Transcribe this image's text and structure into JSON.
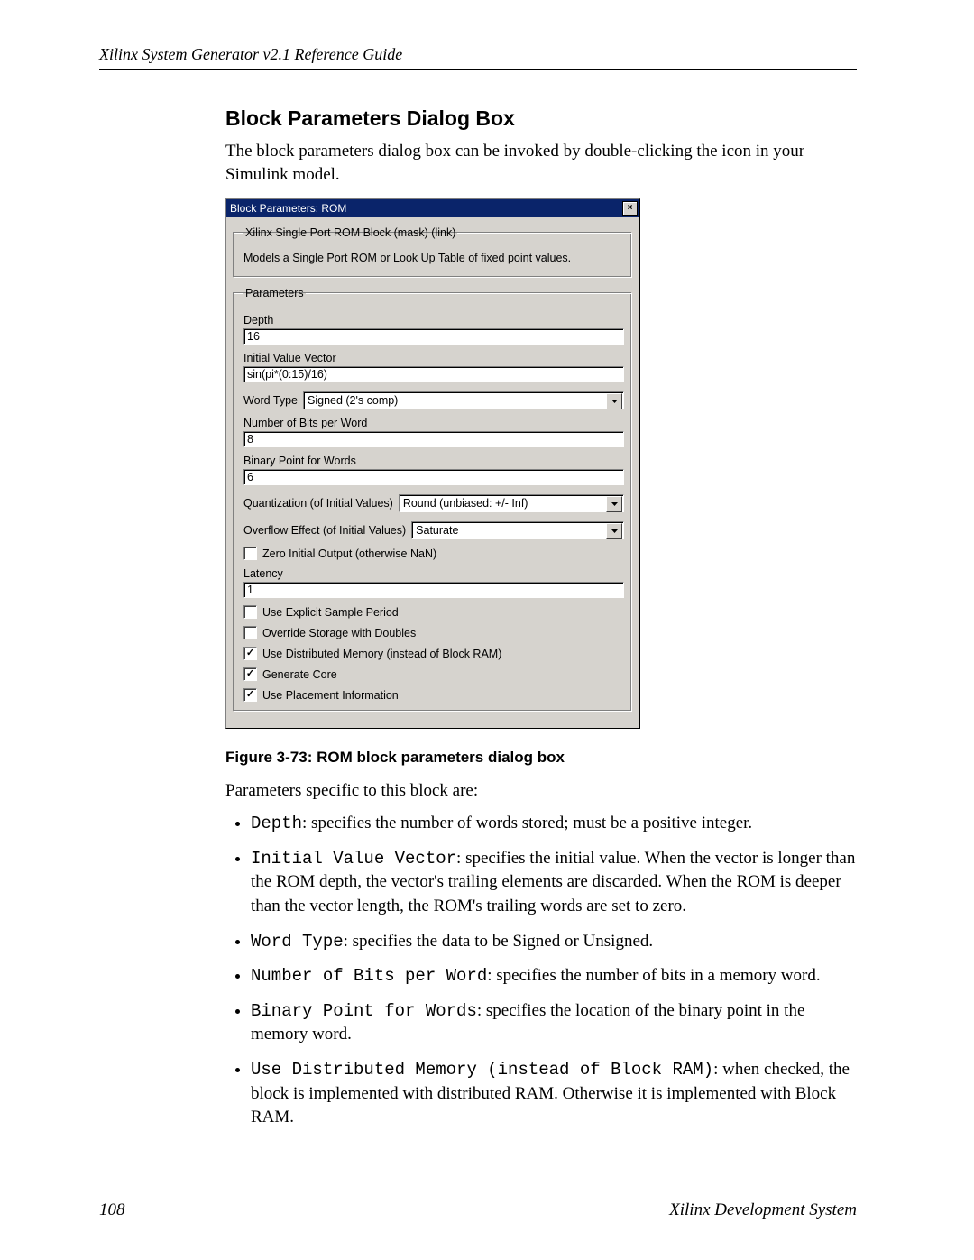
{
  "header": {
    "running": "Xilinx System Generator v2.1 Reference Guide"
  },
  "section": {
    "title": "Block Parameters Dialog Box",
    "intro": "The block parameters dialog box can be invoked by double-clicking the icon in your Simulink model."
  },
  "dialog": {
    "title": "Block Parameters: ROM",
    "group1_legend": "Xilinx Single Port ROM Block (mask) (link)",
    "group1_desc": "Models a Single Port ROM or Look Up Table of fixed point values.",
    "params_legend": "Parameters",
    "labels": {
      "depth": "Depth",
      "ivv": "Initial Value Vector",
      "wordtype": "Word Type",
      "nbits": "Number of Bits per Word",
      "bpw": "Binary Point for Words",
      "quant": "Quantization (of Initial Values)",
      "oflow": "Overflow Effect (of Initial Values)",
      "latency": "Latency"
    },
    "values": {
      "depth": "16",
      "ivv": "sin(pi*(0:15)/16)",
      "wordtype": "Signed  (2's comp)",
      "nbits": "8",
      "bpw": "6",
      "quant": "Round  (unbiased: +/- Inf)",
      "oflow": "Saturate",
      "latency": "1"
    },
    "checks": {
      "zero_initial": "Zero Initial Output  (otherwise NaN)",
      "explicit_sp": "Use Explicit Sample Period",
      "override_dbl": "Override Storage with Doubles",
      "dist_mem": "Use Distributed Memory (instead of Block RAM)",
      "gen_core": "Generate Core",
      "use_place": "Use Placement Information"
    }
  },
  "figure": {
    "caption": "Figure 3-73:   ROM block parameters dialog box"
  },
  "paratext": "Parameters specific to this block are:",
  "bullets": {
    "b1_code": "Depth",
    "b1_text": ": specifies the number of words stored; must be a positive integer.",
    "b2_code": "Initial Value Vector",
    "b2_text": ": specifies the initial value. When the vector is longer than the ROM depth, the vector's trailing elements are discarded. When the ROM is deeper than the vector length, the ROM's trailing words are set to zero.",
    "b3_code": "Word Type",
    "b3_text": ": specifies the data to be Signed or Unsigned.",
    "b4_code": "Number of Bits per Word",
    "b4_text": ": specifies the number of bits in a memory word.",
    "b5_code": "Binary Point for Words",
    "b5_text": ": specifies the location of the binary point in the memory word.",
    "b6_code": "Use Distributed Memory (instead of Block RAM)",
    "b6_text": ": when checked, the block is implemented with distributed RAM. Otherwise it is implemented with Block RAM."
  },
  "footer": {
    "pagenum": "108",
    "brand": "Xilinx Development System"
  }
}
